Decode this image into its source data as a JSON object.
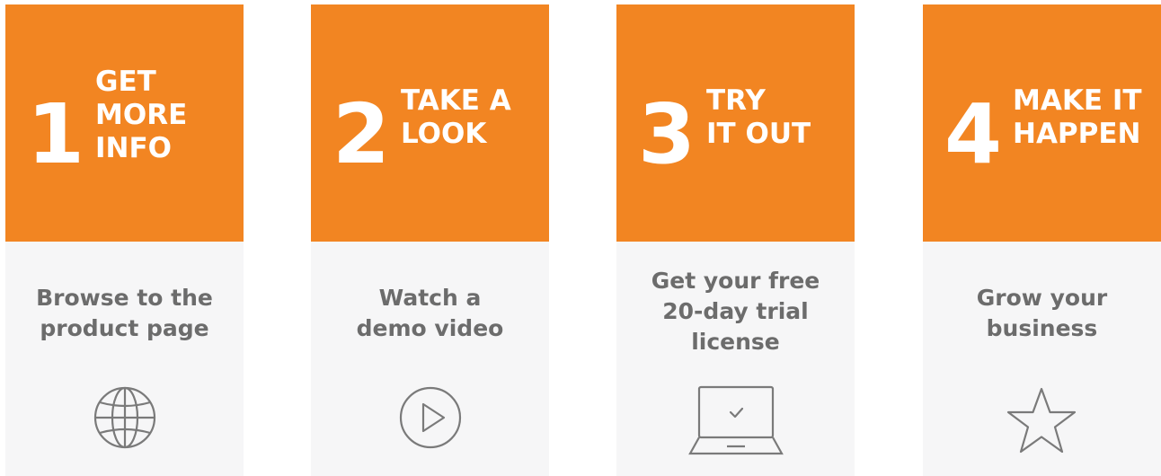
{
  "steps": [
    {
      "number": "1",
      "title": "GET\nMORE\nINFO",
      "description": "Browse to the\nproduct page",
      "icon": "globe-icon"
    },
    {
      "number": "2",
      "title": "TAKE A\nLOOK",
      "description": "Watch a\ndemo video",
      "icon": "play-icon"
    },
    {
      "number": "3",
      "title": "TRY\nIT OUT",
      "description": "Get your free\n20-day trial\nlicense",
      "icon": "laptop-check-icon"
    },
    {
      "number": "4",
      "title": "MAKE IT\nHAPPEN",
      "description": "Grow your\nbusiness",
      "icon": "star-icon"
    }
  ],
  "colors": {
    "accent": "#f28522",
    "panel": "#f6f6f7",
    "text_gray": "#6c6c6c",
    "icon_gray": "#7a7a7a"
  }
}
